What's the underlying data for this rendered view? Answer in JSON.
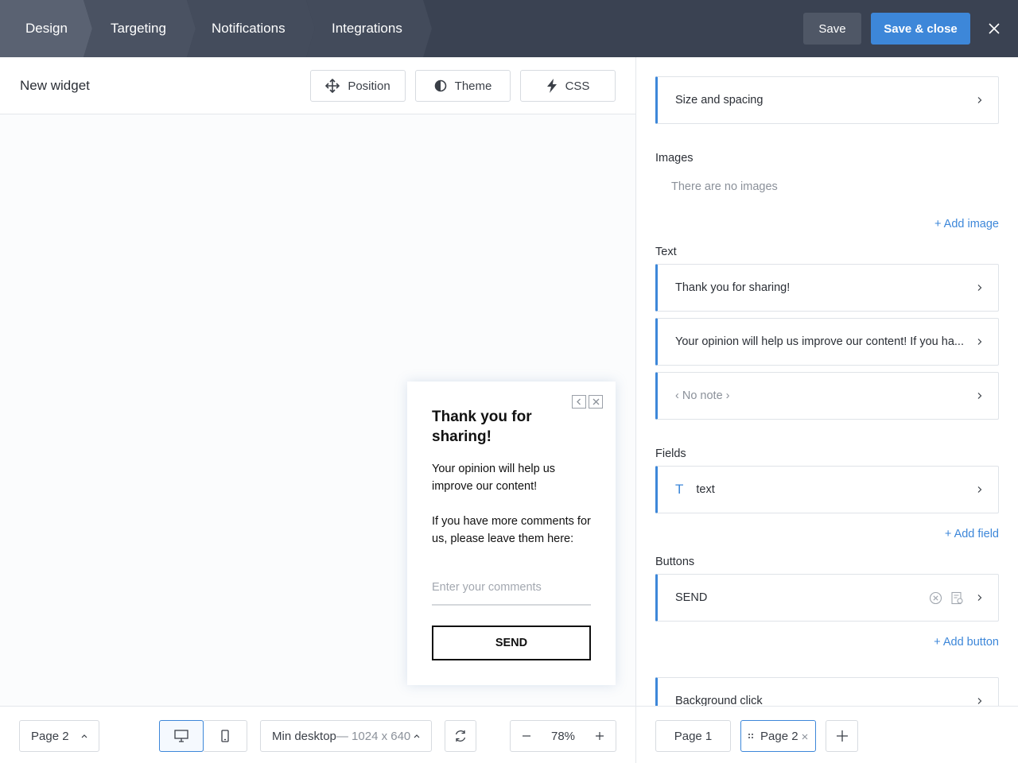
{
  "topbar": {
    "steps": [
      {
        "label": "Design"
      },
      {
        "label": "Targeting"
      },
      {
        "label": "Notifications"
      },
      {
        "label": "Integrations"
      }
    ],
    "save_label": "Save",
    "save_close_label": "Save & close"
  },
  "editor": {
    "widget_title": "New widget",
    "position_label": "Position",
    "theme_label": "Theme",
    "css_label": "CSS"
  },
  "popup": {
    "title": "Thank you for sharing!",
    "body_line1": "Your opinion will help us improve our content!",
    "body_line2": "If you have more comments for us, please leave them here:",
    "input_placeholder": "Enter your comments",
    "button_label": "SEND"
  },
  "bottom_left": {
    "page_select": "Page 2",
    "viewport_label": "Min desktop",
    "viewport_size": "— 1024 x 640",
    "zoom": "78%"
  },
  "sidebar": {
    "size_spacing": "Size and spacing",
    "images_label": "Images",
    "images_empty": "There are no images",
    "add_image": "+ Add image",
    "text_label": "Text",
    "text_items": [
      "Thank you for sharing!",
      "Your opinion will help us improve our content!  If you ha...",
      "‹ No note ›"
    ],
    "fields_label": "Fields",
    "field_item": "text",
    "field_icon_letter": "T",
    "add_field": "+ Add field",
    "buttons_label": "Buttons",
    "button_item": "SEND",
    "add_button": "+ Add button",
    "background_click": "Background click"
  },
  "bottom_right": {
    "pages": [
      "Page 1",
      "Page 2"
    ]
  },
  "colors": {
    "topbar_bg": "#3a4252",
    "accent": "#3d87d9",
    "save_close_bg": "#3d87d9"
  }
}
